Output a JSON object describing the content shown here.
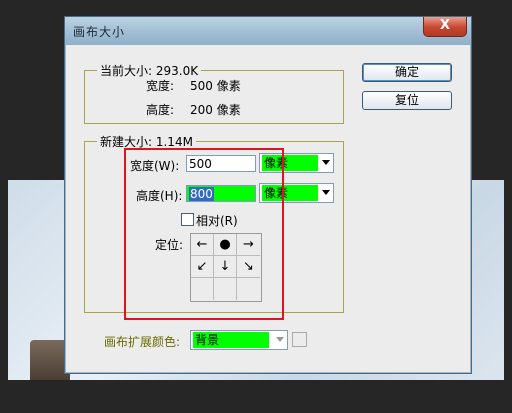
{
  "window": {
    "title": "画布大小",
    "close_glyph": "X"
  },
  "current_size": {
    "label": "当前大小: 293.0K",
    "width_label": "宽度:",
    "width_value": "500 像素",
    "height_label": "高度:",
    "height_value": "200 像素"
  },
  "new_size": {
    "label": "新建大小: 1.14M",
    "width_label": "宽度(W):",
    "width_value": "500",
    "width_unit": "像素",
    "height_label": "高度(H):",
    "height_value": "800",
    "height_unit": "像素",
    "relative_label": "相对(R)",
    "anchor_label": "定位:",
    "anchor_glyphs": [
      "←",
      "●",
      "→",
      "↙",
      "↓",
      "↘",
      "",
      "",
      ""
    ]
  },
  "buttons": {
    "ok": "确定",
    "reset": "复位"
  },
  "extension": {
    "label": "画布扩展颜色:",
    "value": "背景"
  },
  "colors": {
    "highlight": "#00ff00",
    "annotation": "#e0141e",
    "group_border": "#a9a34a"
  }
}
